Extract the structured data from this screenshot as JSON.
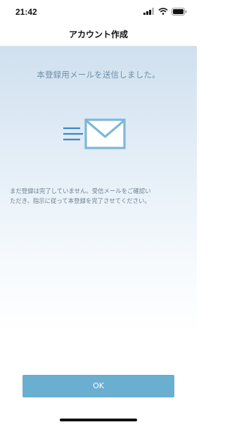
{
  "status_bar": {
    "time": "21:42",
    "icons": [
      "signal-icon",
      "wifi-icon",
      "battery-icon"
    ]
  },
  "nav": {
    "title": "アカウント作成"
  },
  "main": {
    "headline": "本登録用メールを送信しました。",
    "illustration": "mail-sent-icon",
    "message": "まだ登録は完了していません。受信メールをご確認い\nただき、指示に従って本登録を完了させてください。"
  },
  "actions": {
    "ok_label": "OK"
  },
  "colors": {
    "accent": "#6aaed0",
    "headline": "#6f8fa8",
    "icon": "#7db8d8",
    "icon_lines": "#3f86c2"
  }
}
